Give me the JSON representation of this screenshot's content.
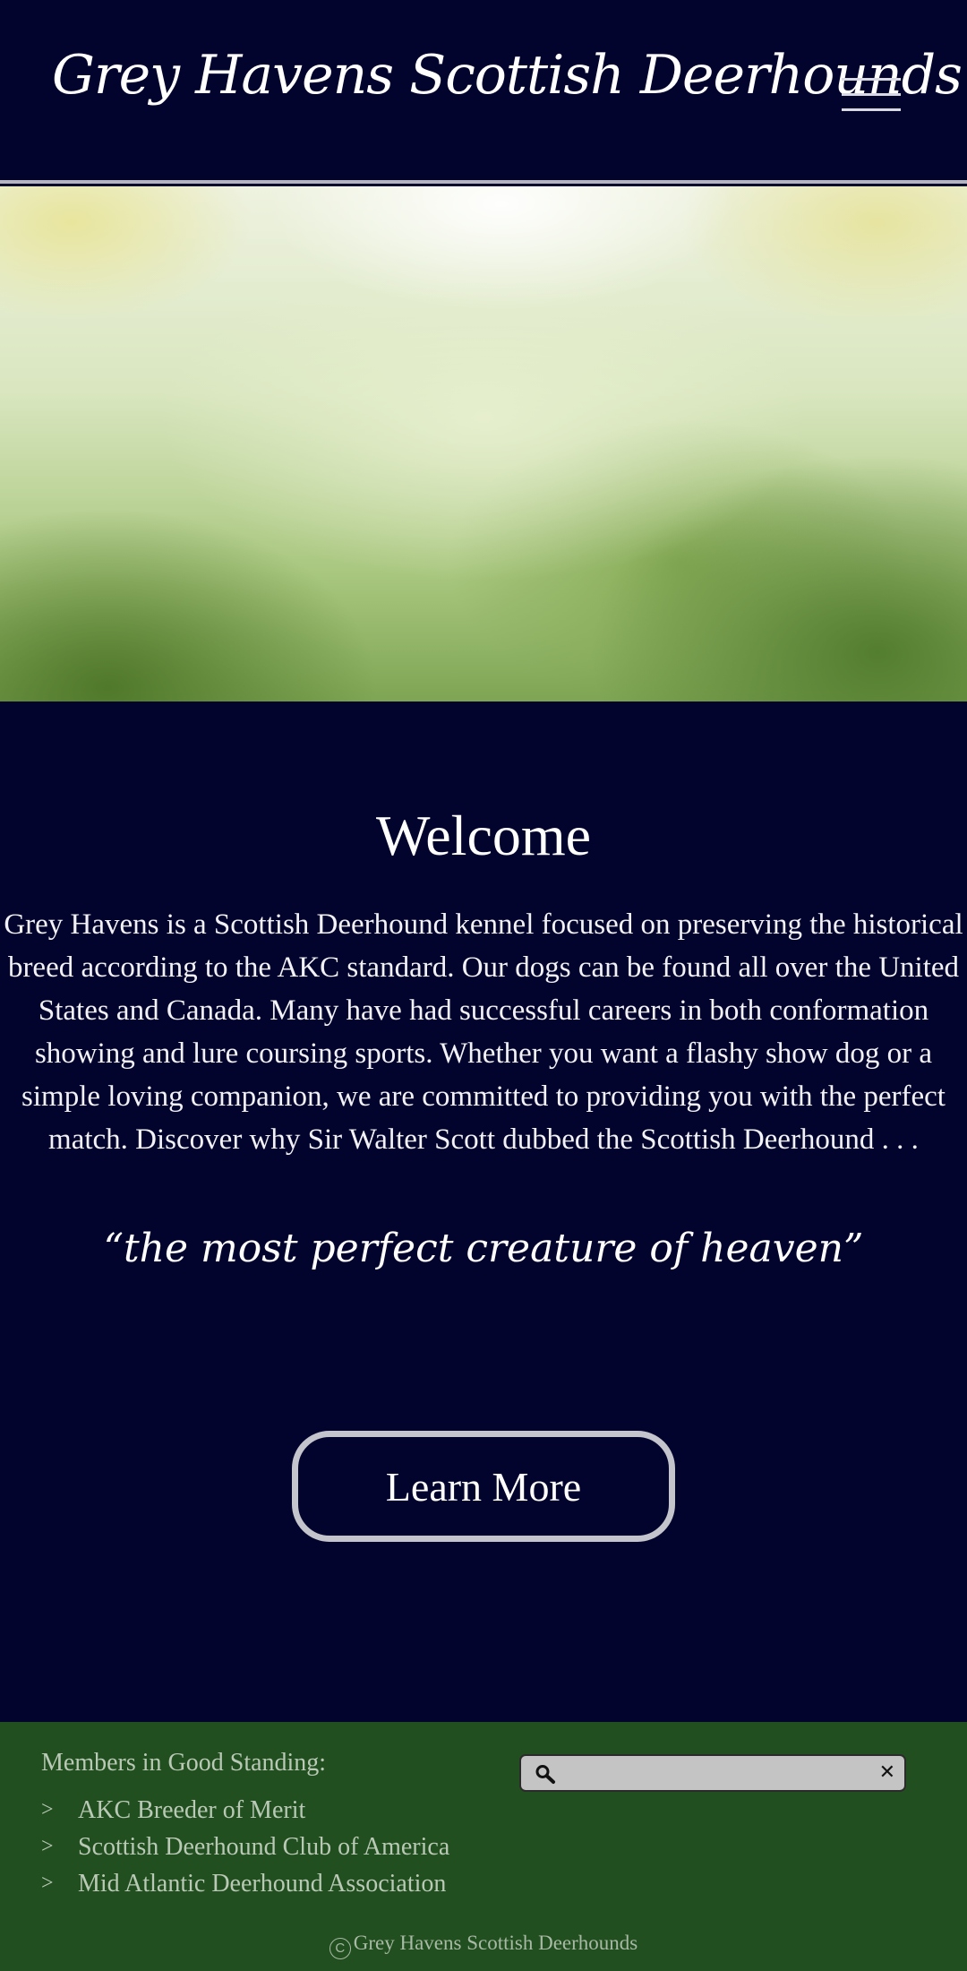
{
  "header": {
    "site_title": "Grey Havens Scottish Deerhounds",
    "menu_icon": "hamburger-menu-icon"
  },
  "hero": {
    "image": "green-yellow-watercolor-banner"
  },
  "main": {
    "title": "Welcome",
    "body": "Grey Havens is a Scottish Deerhound kennel focused on preserving the historical breed according to the AKC  standard. Our dogs can be found all over the United States and Canada. Many have had successful careers in both conformation showing and lure coursing sports. Whether you want a flashy show dog or a simple loving companion, we are committed to providing you with the perfect match. Discover why Sir Walter Scott dubbed the Scottish Deerhound . . .",
    "quote": "“the most perfect creature of heaven”",
    "cta_label": "Learn More"
  },
  "footer": {
    "members_title": "Members in Good Standing:",
    "bullet": ">",
    "members": [
      "AKC Breeder of Merit",
      "Scottish Deerhound Club of America",
      "Mid Atlantic Deerhound Association"
    ],
    "search": {
      "placeholder": "",
      "search_icon": "search-icon",
      "clear_symbol": "✕"
    },
    "copyright_symbol": "C",
    "copyright_text": "Grey Havens Scottish Deerhounds"
  },
  "colors": {
    "background": "#03042d",
    "footer_background": "#224f1f",
    "button_border": "#c4c4cc",
    "footer_text": "#b9c9b6"
  }
}
